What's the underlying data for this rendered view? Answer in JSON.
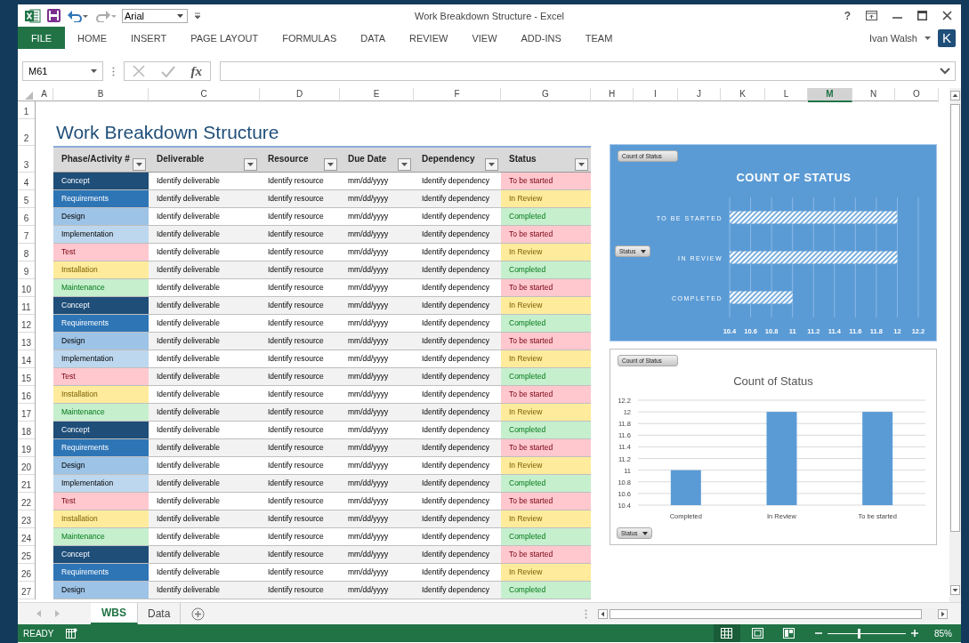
{
  "window": {
    "title": "Work Breakdown Structure - Excel",
    "help": "?"
  },
  "quick_access": {
    "font": "Arial"
  },
  "ribbon_tabs": [
    {
      "label": "FILE",
      "selected": true
    },
    {
      "label": "HOME",
      "selected": false
    },
    {
      "label": "INSERT",
      "selected": false
    },
    {
      "label": "PAGE LAYOUT",
      "selected": false
    },
    {
      "label": "FORMULAS",
      "selected": false
    },
    {
      "label": "DATA",
      "selected": false
    },
    {
      "label": "REVIEW",
      "selected": false
    },
    {
      "label": "VIEW",
      "selected": false
    },
    {
      "label": "ADD-INS",
      "selected": false
    },
    {
      "label": "TEAM",
      "selected": false
    }
  ],
  "user": {
    "name": "Ivan Walsh",
    "initial": "K"
  },
  "formula_bar": {
    "name_box": "M61",
    "function_label": "fx"
  },
  "columns": [
    {
      "label": "A",
      "selected": false
    },
    {
      "label": "B",
      "selected": false
    },
    {
      "label": "C",
      "selected": false
    },
    {
      "label": "D",
      "selected": false
    },
    {
      "label": "E",
      "selected": false
    },
    {
      "label": "F",
      "selected": false
    },
    {
      "label": "G",
      "selected": false
    },
    {
      "label": "H",
      "selected": false
    },
    {
      "label": "I",
      "selected": false
    },
    {
      "label": "J",
      "selected": false
    },
    {
      "label": "K",
      "selected": false
    },
    {
      "label": "L",
      "selected": false
    },
    {
      "label": "M",
      "selected": true
    },
    {
      "label": "N",
      "selected": false
    },
    {
      "label": "O",
      "selected": false
    }
  ],
  "row_numbers": [
    "1",
    "2",
    "3",
    "4",
    "5",
    "6",
    "7",
    "8",
    "9",
    "10",
    "11",
    "12",
    "13",
    "14",
    "15",
    "16",
    "17",
    "18",
    "19",
    "20",
    "21",
    "22",
    "23",
    "24",
    "25",
    "26",
    "27"
  ],
  "sheet_title": "Work Breakdown Structure",
  "table": {
    "columns": [
      "Phase/Activity #",
      "Deliverable",
      "Resource",
      "Due Date",
      "Dependency",
      "Status"
    ],
    "rows": [
      {
        "phase": {
          "text": "Concept",
          "color": "#1f4e79"
        },
        "deliverable": "Identify deliverable",
        "resource": "Identify resource",
        "due_date": "mm/dd/yyyy",
        "dependency": "Identify dependency",
        "status": {
          "text": "To be started",
          "color": "#ffc7ce"
        }
      },
      {
        "phase": {
          "text": "Requirements",
          "color": "#2e75b6"
        },
        "deliverable": "Identify deliverable",
        "resource": "Identify resource",
        "due_date": "mm/dd/yyyy",
        "dependency": "Identify dependency",
        "status": {
          "text": "In Review",
          "color": "#ffeb9c"
        }
      },
      {
        "phase": {
          "text": "Design",
          "color": "#9dc3e6"
        },
        "deliverable": "Identify deliverable",
        "resource": "Identify resource",
        "due_date": "mm/dd/yyyy",
        "dependency": "Identify dependency",
        "status": {
          "text": "Completed",
          "color": "#c6efce"
        }
      },
      {
        "phase": {
          "text": "Implementation",
          "color": "#bdd7ee"
        },
        "deliverable": "Identify deliverable",
        "resource": "Identify resource",
        "due_date": "mm/dd/yyyy",
        "dependency": "Identify dependency",
        "status": {
          "text": "To be started",
          "color": "#ffc7ce"
        }
      },
      {
        "phase": {
          "text": "Test",
          "color": "#ffc7ce"
        },
        "deliverable": "Identify deliverable",
        "resource": "Identify resource",
        "due_date": "mm/dd/yyyy",
        "dependency": "Identify dependency",
        "status": {
          "text": "In Review",
          "color": "#ffeb9c"
        }
      },
      {
        "phase": {
          "text": "Installation",
          "color": "#ffeb9c"
        },
        "deliverable": "Identify deliverable",
        "resource": "Identify resource",
        "due_date": "mm/dd/yyyy",
        "dependency": "Identify dependency",
        "status": {
          "text": "Completed",
          "color": "#c6efce"
        }
      },
      {
        "phase": {
          "text": "Maintenance",
          "color": "#c6efce"
        },
        "deliverable": "Identify deliverable",
        "resource": "Identify resource",
        "due_date": "mm/dd/yyyy",
        "dependency": "Identify dependency",
        "status": {
          "text": "To be started",
          "color": "#ffc7ce"
        }
      },
      {
        "phase": {
          "text": "Concept",
          "color": "#1f4e79"
        },
        "deliverable": "Identify deliverable",
        "resource": "Identify resource",
        "due_date": "mm/dd/yyyy",
        "dependency": "Identify dependency",
        "status": {
          "text": "In Review",
          "color": "#ffeb9c"
        }
      },
      {
        "phase": {
          "text": "Requirements",
          "color": "#2e75b6"
        },
        "deliverable": "Identify deliverable",
        "resource": "Identify resource",
        "due_date": "mm/dd/yyyy",
        "dependency": "Identify dependency",
        "status": {
          "text": "Completed",
          "color": "#c6efce"
        }
      },
      {
        "phase": {
          "text": "Design",
          "color": "#9dc3e6"
        },
        "deliverable": "Identify deliverable",
        "resource": "Identify resource",
        "due_date": "mm/dd/yyyy",
        "dependency": "Identify dependency",
        "status": {
          "text": "To be started",
          "color": "#ffc7ce"
        }
      },
      {
        "phase": {
          "text": "Implementation",
          "color": "#bdd7ee"
        },
        "deliverable": "Identify deliverable",
        "resource": "Identify resource",
        "due_date": "mm/dd/yyyy",
        "dependency": "Identify dependency",
        "status": {
          "text": "In Review",
          "color": "#ffeb9c"
        }
      },
      {
        "phase": {
          "text": "Test",
          "color": "#ffc7ce"
        },
        "deliverable": "Identify deliverable",
        "resource": "Identify resource",
        "due_date": "mm/dd/yyyy",
        "dependency": "Identify dependency",
        "status": {
          "text": "Completed",
          "color": "#c6efce"
        }
      },
      {
        "phase": {
          "text": "Installation",
          "color": "#ffeb9c"
        },
        "deliverable": "Identify deliverable",
        "resource": "Identify resource",
        "due_date": "mm/dd/yyyy",
        "dependency": "Identify dependency",
        "status": {
          "text": "To be started",
          "color": "#ffc7ce"
        }
      },
      {
        "phase": {
          "text": "Maintenance",
          "color": "#c6efce"
        },
        "deliverable": "Identify deliverable",
        "resource": "Identify resource",
        "due_date": "mm/dd/yyyy",
        "dependency": "Identify dependency",
        "status": {
          "text": "In Review",
          "color": "#ffeb9c"
        }
      },
      {
        "phase": {
          "text": "Concept",
          "color": "#1f4e79"
        },
        "deliverable": "Identify deliverable",
        "resource": "Identify resource",
        "due_date": "mm/dd/yyyy",
        "dependency": "Identify dependency",
        "status": {
          "text": "Completed",
          "color": "#c6efce"
        }
      },
      {
        "phase": {
          "text": "Requirements",
          "color": "#2e75b6"
        },
        "deliverable": "Identify deliverable",
        "resource": "Identify resource",
        "due_date": "mm/dd/yyyy",
        "dependency": "Identify dependency",
        "status": {
          "text": "To be started",
          "color": "#ffc7ce"
        }
      },
      {
        "phase": {
          "text": "Design",
          "color": "#9dc3e6"
        },
        "deliverable": "Identify deliverable",
        "resource": "Identify resource",
        "due_date": "mm/dd/yyyy",
        "dependency": "Identify dependency",
        "status": {
          "text": "In Review",
          "color": "#ffeb9c"
        }
      },
      {
        "phase": {
          "text": "Implementation",
          "color": "#bdd7ee"
        },
        "deliverable": "Identify deliverable",
        "resource": "Identify resource",
        "due_date": "mm/dd/yyyy",
        "dependency": "Identify dependency",
        "status": {
          "text": "Completed",
          "color": "#c6efce"
        }
      },
      {
        "phase": {
          "text": "Test",
          "color": "#ffc7ce"
        },
        "deliverable": "Identify deliverable",
        "resource": "Identify resource",
        "due_date": "mm/dd/yyyy",
        "dependency": "Identify dependency",
        "status": {
          "text": "To be started",
          "color": "#ffc7ce"
        }
      },
      {
        "phase": {
          "text": "Installation",
          "color": "#ffeb9c"
        },
        "deliverable": "Identify deliverable",
        "resource": "Identify resource",
        "due_date": "mm/dd/yyyy",
        "dependency": "Identify dependency",
        "status": {
          "text": "In Review",
          "color": "#ffeb9c"
        }
      },
      {
        "phase": {
          "text": "Maintenance",
          "color": "#c6efce"
        },
        "deliverable": "Identify deliverable",
        "resource": "Identify resource",
        "due_date": "mm/dd/yyyy",
        "dependency": "Identify dependency",
        "status": {
          "text": "Completed",
          "color": "#c6efce"
        }
      },
      {
        "phase": {
          "text": "Concept",
          "color": "#1f4e79"
        },
        "deliverable": "Identify deliverable",
        "resource": "Identify resource",
        "due_date": "mm/dd/yyyy",
        "dependency": "Identify dependency",
        "status": {
          "text": "To be started",
          "color": "#ffc7ce"
        }
      },
      {
        "phase": {
          "text": "Requirements",
          "color": "#2e75b6"
        },
        "deliverable": "Identify deliverable",
        "resource": "Identify resource",
        "due_date": "mm/dd/yyyy",
        "dependency": "Identify dependency",
        "status": {
          "text": "In Review",
          "color": "#ffeb9c"
        }
      },
      {
        "phase": {
          "text": "Design",
          "color": "#9dc3e6"
        },
        "deliverable": "Identify deliverable",
        "resource": "Identify resource",
        "due_date": "mm/dd/yyyy",
        "dependency": "Identify dependency",
        "status": {
          "text": "Completed",
          "color": "#c6efce"
        }
      }
    ]
  },
  "charts": [
    {
      "pivot_value": "Count of Status",
      "pivot_field": "Status",
      "chart_data": {
        "type": "bar",
        "orientation": "horizontal",
        "title": "COUNT OF STATUS",
        "categories": [
          "TO BE STARTED",
          "IN REVIEW",
          "COMPLETED"
        ],
        "values": [
          12,
          12,
          11
        ],
        "grid": true,
        "xlim": [
          10.4,
          12.2
        ],
        "xticks": [
          10.4,
          10.6,
          10.8,
          11,
          11.2,
          11.4,
          11.6,
          11.8,
          12,
          12.2
        ]
      }
    },
    {
      "pivot_value": "Count of Status",
      "pivot_field": "Status",
      "chart_data": {
        "type": "bar",
        "orientation": "vertical",
        "title": "Count of Status",
        "categories": [
          "Completed",
          "In Review",
          "To be started"
        ],
        "values": [
          11,
          12,
          12
        ],
        "grid": true,
        "ylim": [
          10.4,
          12.2
        ],
        "yticks": [
          10.4,
          10.6,
          10.8,
          11,
          11.2,
          11.4,
          11.6,
          11.8,
          12,
          12.2
        ]
      }
    }
  ],
  "sheet_tabs": [
    {
      "label": "WBS",
      "selected": true
    },
    {
      "label": "Data",
      "selected": false
    }
  ],
  "status_bar": {
    "text": "READY",
    "views": [
      {
        "kind": "normal",
        "selected": true
      },
      {
        "kind": "page-layout",
        "selected": false
      },
      {
        "kind": "page-break",
        "selected": false
      }
    ],
    "zoom": {
      "level": 0.39,
      "reading": "85%"
    }
  }
}
